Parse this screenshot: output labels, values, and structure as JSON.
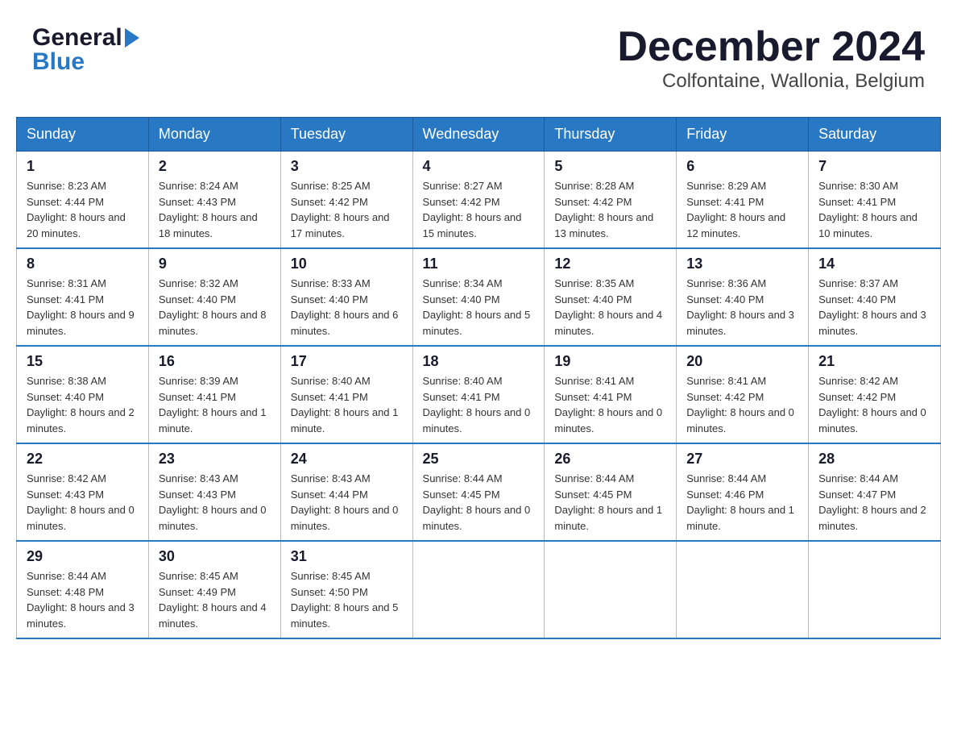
{
  "logo": {
    "general": "General",
    "blue": "Blue"
  },
  "header": {
    "month_year": "December 2024",
    "location": "Colfontaine, Wallonia, Belgium"
  },
  "weekdays": [
    "Sunday",
    "Monday",
    "Tuesday",
    "Wednesday",
    "Thursday",
    "Friday",
    "Saturday"
  ],
  "weeks": [
    [
      {
        "day": "1",
        "sunrise": "8:23 AM",
        "sunset": "4:44 PM",
        "daylight": "8 hours and 20 minutes."
      },
      {
        "day": "2",
        "sunrise": "8:24 AM",
        "sunset": "4:43 PM",
        "daylight": "8 hours and 18 minutes."
      },
      {
        "day": "3",
        "sunrise": "8:25 AM",
        "sunset": "4:42 PM",
        "daylight": "8 hours and 17 minutes."
      },
      {
        "day": "4",
        "sunrise": "8:27 AM",
        "sunset": "4:42 PM",
        "daylight": "8 hours and 15 minutes."
      },
      {
        "day": "5",
        "sunrise": "8:28 AM",
        "sunset": "4:42 PM",
        "daylight": "8 hours and 13 minutes."
      },
      {
        "day": "6",
        "sunrise": "8:29 AM",
        "sunset": "4:41 PM",
        "daylight": "8 hours and 12 minutes."
      },
      {
        "day": "7",
        "sunrise": "8:30 AM",
        "sunset": "4:41 PM",
        "daylight": "8 hours and 10 minutes."
      }
    ],
    [
      {
        "day": "8",
        "sunrise": "8:31 AM",
        "sunset": "4:41 PM",
        "daylight": "8 hours and 9 minutes."
      },
      {
        "day": "9",
        "sunrise": "8:32 AM",
        "sunset": "4:40 PM",
        "daylight": "8 hours and 8 minutes."
      },
      {
        "day": "10",
        "sunrise": "8:33 AM",
        "sunset": "4:40 PM",
        "daylight": "8 hours and 6 minutes."
      },
      {
        "day": "11",
        "sunrise": "8:34 AM",
        "sunset": "4:40 PM",
        "daylight": "8 hours and 5 minutes."
      },
      {
        "day": "12",
        "sunrise": "8:35 AM",
        "sunset": "4:40 PM",
        "daylight": "8 hours and 4 minutes."
      },
      {
        "day": "13",
        "sunrise": "8:36 AM",
        "sunset": "4:40 PM",
        "daylight": "8 hours and 3 minutes."
      },
      {
        "day": "14",
        "sunrise": "8:37 AM",
        "sunset": "4:40 PM",
        "daylight": "8 hours and 3 minutes."
      }
    ],
    [
      {
        "day": "15",
        "sunrise": "8:38 AM",
        "sunset": "4:40 PM",
        "daylight": "8 hours and 2 minutes."
      },
      {
        "day": "16",
        "sunrise": "8:39 AM",
        "sunset": "4:41 PM",
        "daylight": "8 hours and 1 minute."
      },
      {
        "day": "17",
        "sunrise": "8:40 AM",
        "sunset": "4:41 PM",
        "daylight": "8 hours and 1 minute."
      },
      {
        "day": "18",
        "sunrise": "8:40 AM",
        "sunset": "4:41 PM",
        "daylight": "8 hours and 0 minutes."
      },
      {
        "day": "19",
        "sunrise": "8:41 AM",
        "sunset": "4:41 PM",
        "daylight": "8 hours and 0 minutes."
      },
      {
        "day": "20",
        "sunrise": "8:41 AM",
        "sunset": "4:42 PM",
        "daylight": "8 hours and 0 minutes."
      },
      {
        "day": "21",
        "sunrise": "8:42 AM",
        "sunset": "4:42 PM",
        "daylight": "8 hours and 0 minutes."
      }
    ],
    [
      {
        "day": "22",
        "sunrise": "8:42 AM",
        "sunset": "4:43 PM",
        "daylight": "8 hours and 0 minutes."
      },
      {
        "day": "23",
        "sunrise": "8:43 AM",
        "sunset": "4:43 PM",
        "daylight": "8 hours and 0 minutes."
      },
      {
        "day": "24",
        "sunrise": "8:43 AM",
        "sunset": "4:44 PM",
        "daylight": "8 hours and 0 minutes."
      },
      {
        "day": "25",
        "sunrise": "8:44 AM",
        "sunset": "4:45 PM",
        "daylight": "8 hours and 0 minutes."
      },
      {
        "day": "26",
        "sunrise": "8:44 AM",
        "sunset": "4:45 PM",
        "daylight": "8 hours and 1 minute."
      },
      {
        "day": "27",
        "sunrise": "8:44 AM",
        "sunset": "4:46 PM",
        "daylight": "8 hours and 1 minute."
      },
      {
        "day": "28",
        "sunrise": "8:44 AM",
        "sunset": "4:47 PM",
        "daylight": "8 hours and 2 minutes."
      }
    ],
    [
      {
        "day": "29",
        "sunrise": "8:44 AM",
        "sunset": "4:48 PM",
        "daylight": "8 hours and 3 minutes."
      },
      {
        "day": "30",
        "sunrise": "8:45 AM",
        "sunset": "4:49 PM",
        "daylight": "8 hours and 4 minutes."
      },
      {
        "day": "31",
        "sunrise": "8:45 AM",
        "sunset": "4:50 PM",
        "daylight": "8 hours and 5 minutes."
      },
      null,
      null,
      null,
      null
    ]
  ]
}
